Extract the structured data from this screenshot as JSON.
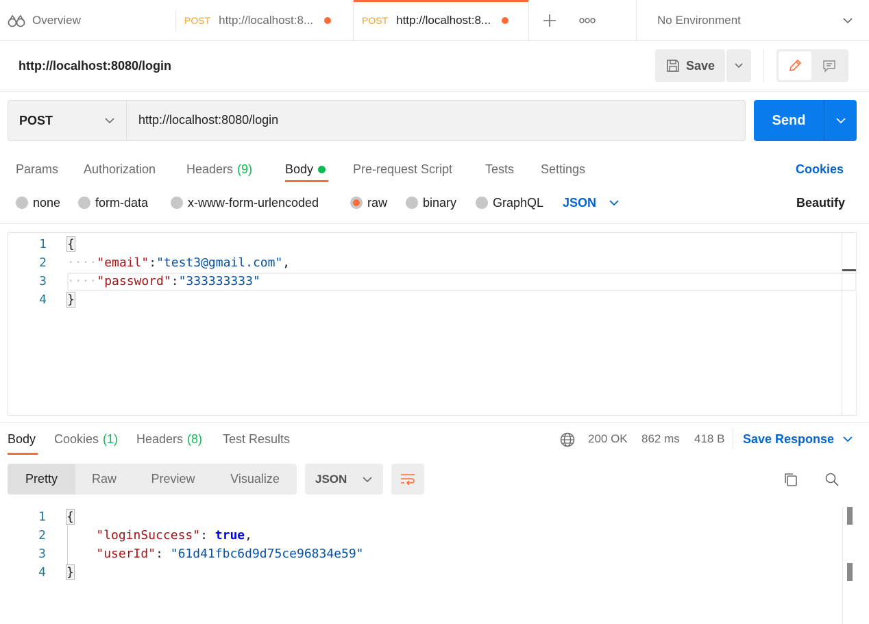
{
  "tabs": {
    "overview_label": "Overview",
    "tab1": {
      "method": "POST",
      "url": "http://localhost:8..."
    },
    "tab2": {
      "method": "POST",
      "url": "http://localhost:8..."
    },
    "environment": "No Environment"
  },
  "request": {
    "title": "http://localhost:8080/login",
    "save_label": "Save",
    "method": "POST",
    "url": "http://localhost:8080/login",
    "send_label": "Send",
    "subtabs": {
      "params": "Params",
      "authorization": "Authorization",
      "headers": "Headers",
      "headers_count": "(9)",
      "body": "Body",
      "prerequest": "Pre-request Script",
      "tests": "Tests",
      "settings": "Settings",
      "cookies": "Cookies"
    },
    "body_types": {
      "none": "none",
      "form_data": "form-data",
      "urlencoded": "x-www-form-urlencoded",
      "raw": "raw",
      "binary": "binary",
      "graphql": "GraphQL",
      "format": "JSON",
      "beautify": "Beautify"
    },
    "body_lines": {
      "n1": "1",
      "n2": "2",
      "n3": "3",
      "n4": "4",
      "open": "{",
      "email_key": "\"email\"",
      "email_val": "\"test3@gmail.com\"",
      "password_key": "\"password\"",
      "password_val": "\"333333333\"",
      "close": "}"
    }
  },
  "response": {
    "tabs": {
      "body": "Body",
      "cookies": "Cookies",
      "cookies_count": "(1)",
      "headers": "Headers",
      "headers_count": "(8)",
      "test_results": "Test Results"
    },
    "status": "200 OK",
    "time": "862 ms",
    "size": "418 B",
    "save_response": "Save Response",
    "views": {
      "pretty": "Pretty",
      "raw": "Raw",
      "preview": "Preview",
      "visualize": "Visualize"
    },
    "format": "JSON",
    "body_lines": {
      "n1": "1",
      "n2": "2",
      "n3": "3",
      "n4": "4",
      "open": "{",
      "login_key": "\"loginSuccess\"",
      "login_val": "true",
      "user_key": "\"userId\"",
      "user_val": "\"61d41fbc6d9d75ce96834e59\"",
      "close": "}"
    }
  },
  "colors": {
    "accent": "#ff6c37",
    "send": "#097bed",
    "link": "#0265d2",
    "success": "#0cbb52",
    "method": "#f2a127"
  }
}
